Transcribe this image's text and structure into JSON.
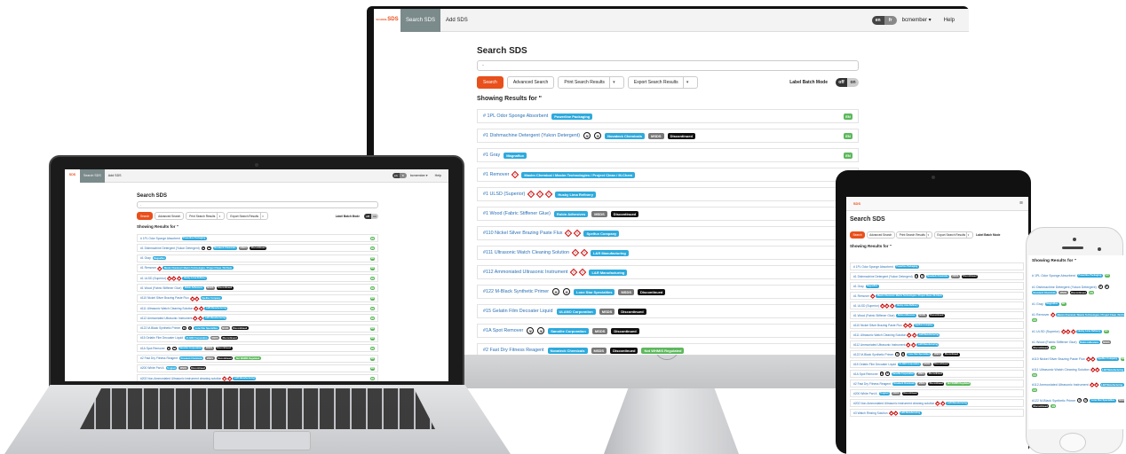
{
  "app": {
    "logo_line1": "SCHOOL",
    "logo_line2": "SDS",
    "nav": [
      "Search SDS",
      "Add SDS"
    ],
    "lang": [
      "en",
      "fr"
    ],
    "user": "bcmember ▾",
    "help": "Help",
    "title": "Search SDS",
    "search_placeholder": "-",
    "buttons": {
      "search": "Search",
      "advanced": "Advanced Search",
      "print": "Print Search Results",
      "export": "Export Search Results",
      "caret": "▾"
    },
    "batch_label": "Label Batch Mode",
    "toggle": [
      "off",
      "on"
    ],
    "results_heading": "Showing Results for",
    "results_query": "\"",
    "en_badge": "EN",
    "menu_icon": "≡"
  },
  "results": [
    {
      "name": "# 1PL Odor Sponge Absorbent",
      "icons": [],
      "tags": [
        {
          "text": "Powerline Packaging",
          "color": "blue"
        }
      ]
    },
    {
      "name": "#1 Dishmachine Detergent (Yukon Detergent)",
      "icons": [
        "circle",
        "circle"
      ],
      "tags": [
        {
          "text": "Novateck Chemicals",
          "color": "blue"
        },
        {
          "text": "MSDS",
          "color": "gray"
        },
        {
          "text": "Discontinued",
          "color": "black"
        }
      ]
    },
    {
      "name": "#1 Gray",
      "icons": [],
      "tags": [
        {
          "text": "Magnaflux",
          "color": "blue"
        }
      ]
    },
    {
      "name": "#1 Remover",
      "icons": [
        "diamond"
      ],
      "tags": [
        {
          "text": "Maxim Chemical / Maxim Technologies / Project Clean / M-Chem",
          "color": "blue"
        }
      ]
    },
    {
      "name": "#1 ULSD (Superior)",
      "icons": [
        "diamond",
        "diamond",
        "diamond"
      ],
      "tags": [
        {
          "text": "Husky Lima Refinery",
          "color": "blue"
        }
      ]
    },
    {
      "name": "#1 Wood (Fabric Stiffener Glue)",
      "icons": [],
      "tags": [
        {
          "text": "Robin Adhesives",
          "color": "blue"
        },
        {
          "text": "MSDS",
          "color": "gray"
        },
        {
          "text": "Discontinued",
          "color": "black"
        }
      ]
    },
    {
      "name": "#110 Nickel Silver Brazing Paste Flux",
      "icons": [
        "diamond",
        "diamond"
      ],
      "tags": [
        {
          "text": "Spelfux Company",
          "color": "blue"
        }
      ]
    },
    {
      "name": "#111 Ultrasonic Watch Cleaning Solution",
      "icons": [
        "diamond",
        "diamond"
      ],
      "tags": [
        {
          "text": "L&R Manufacturing",
          "color": "blue"
        }
      ]
    },
    {
      "name": "#112 Ammoniated Ultrasonic Instrument",
      "icons": [
        "diamond",
        "diamond"
      ],
      "tags": [
        {
          "text": "L&R Manufacturing",
          "color": "blue"
        }
      ]
    },
    {
      "name": "#122 M-Black Synthetic Primer",
      "icons": [
        "circle",
        "circle"
      ],
      "tags": [
        {
          "text": "Lone Star Specialties",
          "color": "blue"
        },
        {
          "text": "MSDS",
          "color": "gray"
        },
        {
          "text": "Discontinued",
          "color": "black"
        }
      ]
    },
    {
      "name": "#15 Gelatin Film Decoater Liquid",
      "icons": [],
      "tags": [
        {
          "text": "ULANO Corporation",
          "color": "blue"
        },
        {
          "text": "MSDS",
          "color": "gray"
        },
        {
          "text": "Discontinued",
          "color": "black"
        }
      ]
    },
    {
      "name": "#1A Spot Remover",
      "icons": [
        "circle",
        "circle"
      ],
      "tags": [
        {
          "text": "Sanolite Corporation",
          "color": "blue"
        },
        {
          "text": "MSDS",
          "color": "gray"
        },
        {
          "text": "Discontinued",
          "color": "black"
        }
      ]
    },
    {
      "name": "#2 Fast Dry Fitness Reagent",
      "icons": [],
      "tags": [
        {
          "text": "Novateck Chemicals",
          "color": "blue"
        },
        {
          "text": "MSDS",
          "color": "gray"
        },
        {
          "text": "Discontinued",
          "color": "black"
        },
        {
          "text": "Not WHMIS Regulated",
          "color": "green"
        }
      ]
    },
    {
      "name": "#200 White Part A",
      "icons": [],
      "tags": [
        {
          "text": "Torginol",
          "color": "blue"
        },
        {
          "text": "MSDS",
          "color": "gray"
        },
        {
          "text": "Discontinued",
          "color": "black"
        }
      ]
    },
    {
      "name": "#202 Non-Ammoniated Ultrasonic instrument cleaning solution",
      "icons": [
        "diamond",
        "diamond"
      ],
      "tags": [
        {
          "text": "L&R Manufacturing",
          "color": "blue"
        }
      ]
    },
    {
      "name": "#3 Watch Rinsing Solution",
      "icons": [
        "diamond",
        "diamond"
      ],
      "tags": [
        {
          "text": "L&R Manufacturing",
          "color": "blue"
        }
      ]
    }
  ]
}
